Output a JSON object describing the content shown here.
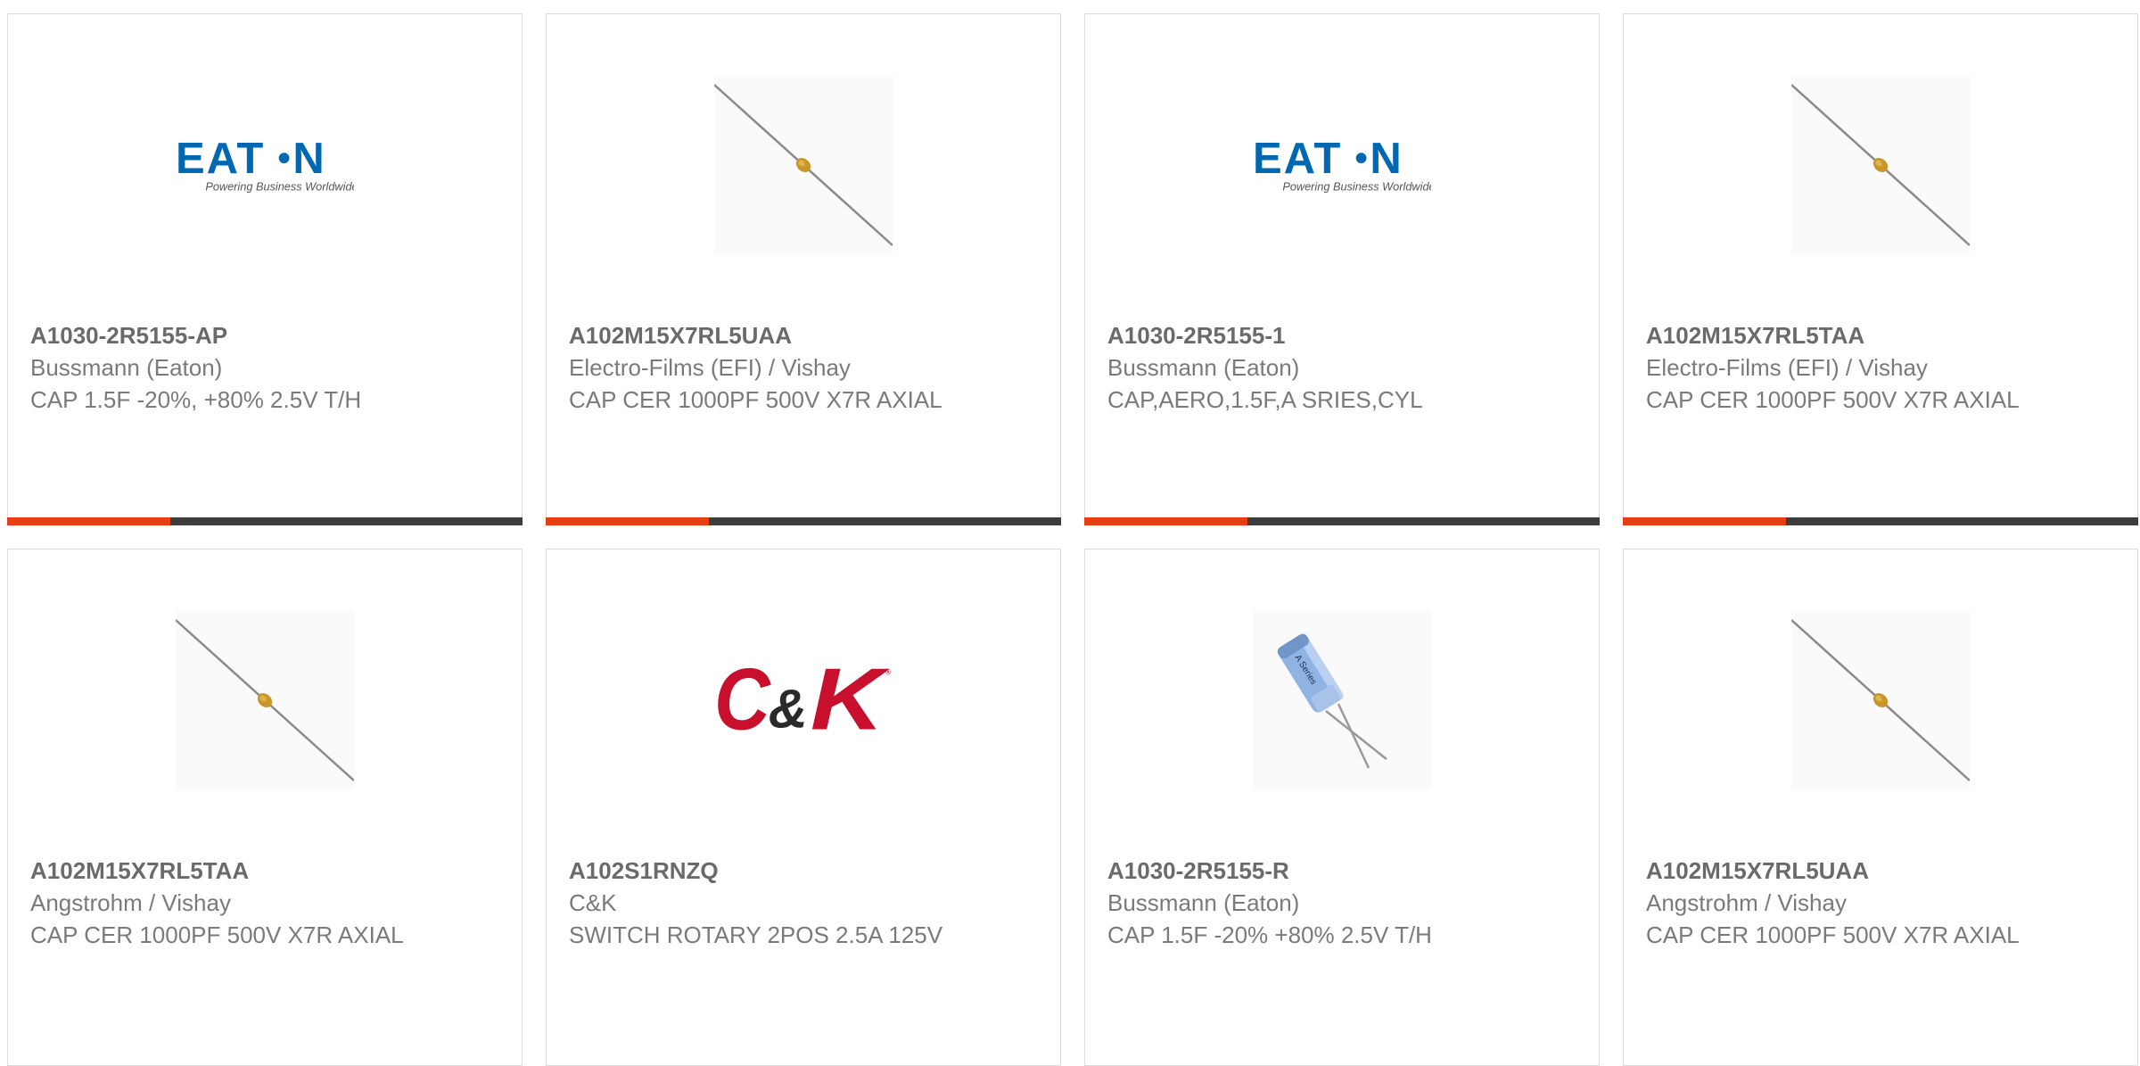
{
  "products": [
    {
      "part_number": "A1030-2R5155-AP",
      "manufacturer": "Bussmann (Eaton)",
      "description": "CAP 1.5F -20%, +80% 2.5V T/H",
      "image": "eaton-logo",
      "logo_tagline": "Powering Business Worldwide"
    },
    {
      "part_number": "A102M15X7RL5UAA",
      "manufacturer": "Electro-Films (EFI) / Vishay",
      "description": "CAP CER 1000PF 500V X7R AXIAL",
      "image": "axial-capacitor-photo"
    },
    {
      "part_number": "A1030-2R5155-1",
      "manufacturer": "Bussmann (Eaton)",
      "description": "CAP,AERO,1.5F,A SRIES,CYL",
      "image": "eaton-logo",
      "logo_tagline": "Powering Business Worldwide"
    },
    {
      "part_number": "A102M15X7RL5TAA",
      "manufacturer": "Electro-Films (EFI) / Vishay",
      "description": "CAP CER 1000PF 500V X7R AXIAL",
      "image": "axial-capacitor-photo"
    },
    {
      "part_number": "A102M15X7RL5TAA",
      "manufacturer": "Angstrohm / Vishay",
      "description": "CAP CER 1000PF 500V X7R AXIAL",
      "image": "axial-capacitor-photo"
    },
    {
      "part_number": "A102S1RNZQ",
      "manufacturer": "C&K",
      "description": "SWITCH ROTARY 2POS 2.5A 125V",
      "image": "ck-logo"
    },
    {
      "part_number": "A1030-2R5155-R",
      "manufacturer": "Bussmann (Eaton)",
      "description": "CAP 1.5F -20% +80% 2.5V T/H",
      "image": "supercapacitor-photo"
    },
    {
      "part_number": "A102M15X7RL5UAA",
      "manufacturer": "Angstrohm / Vishay",
      "description": "CAP CER 1000PF 500V X7R AXIAL",
      "image": "axial-capacitor-photo"
    }
  ],
  "colors": {
    "accent": "#e63e10",
    "bar_dark": "#3d3d3d",
    "eaton_blue": "#0067b1",
    "ck_red": "#c8102e",
    "text": "#7a7a7a"
  }
}
